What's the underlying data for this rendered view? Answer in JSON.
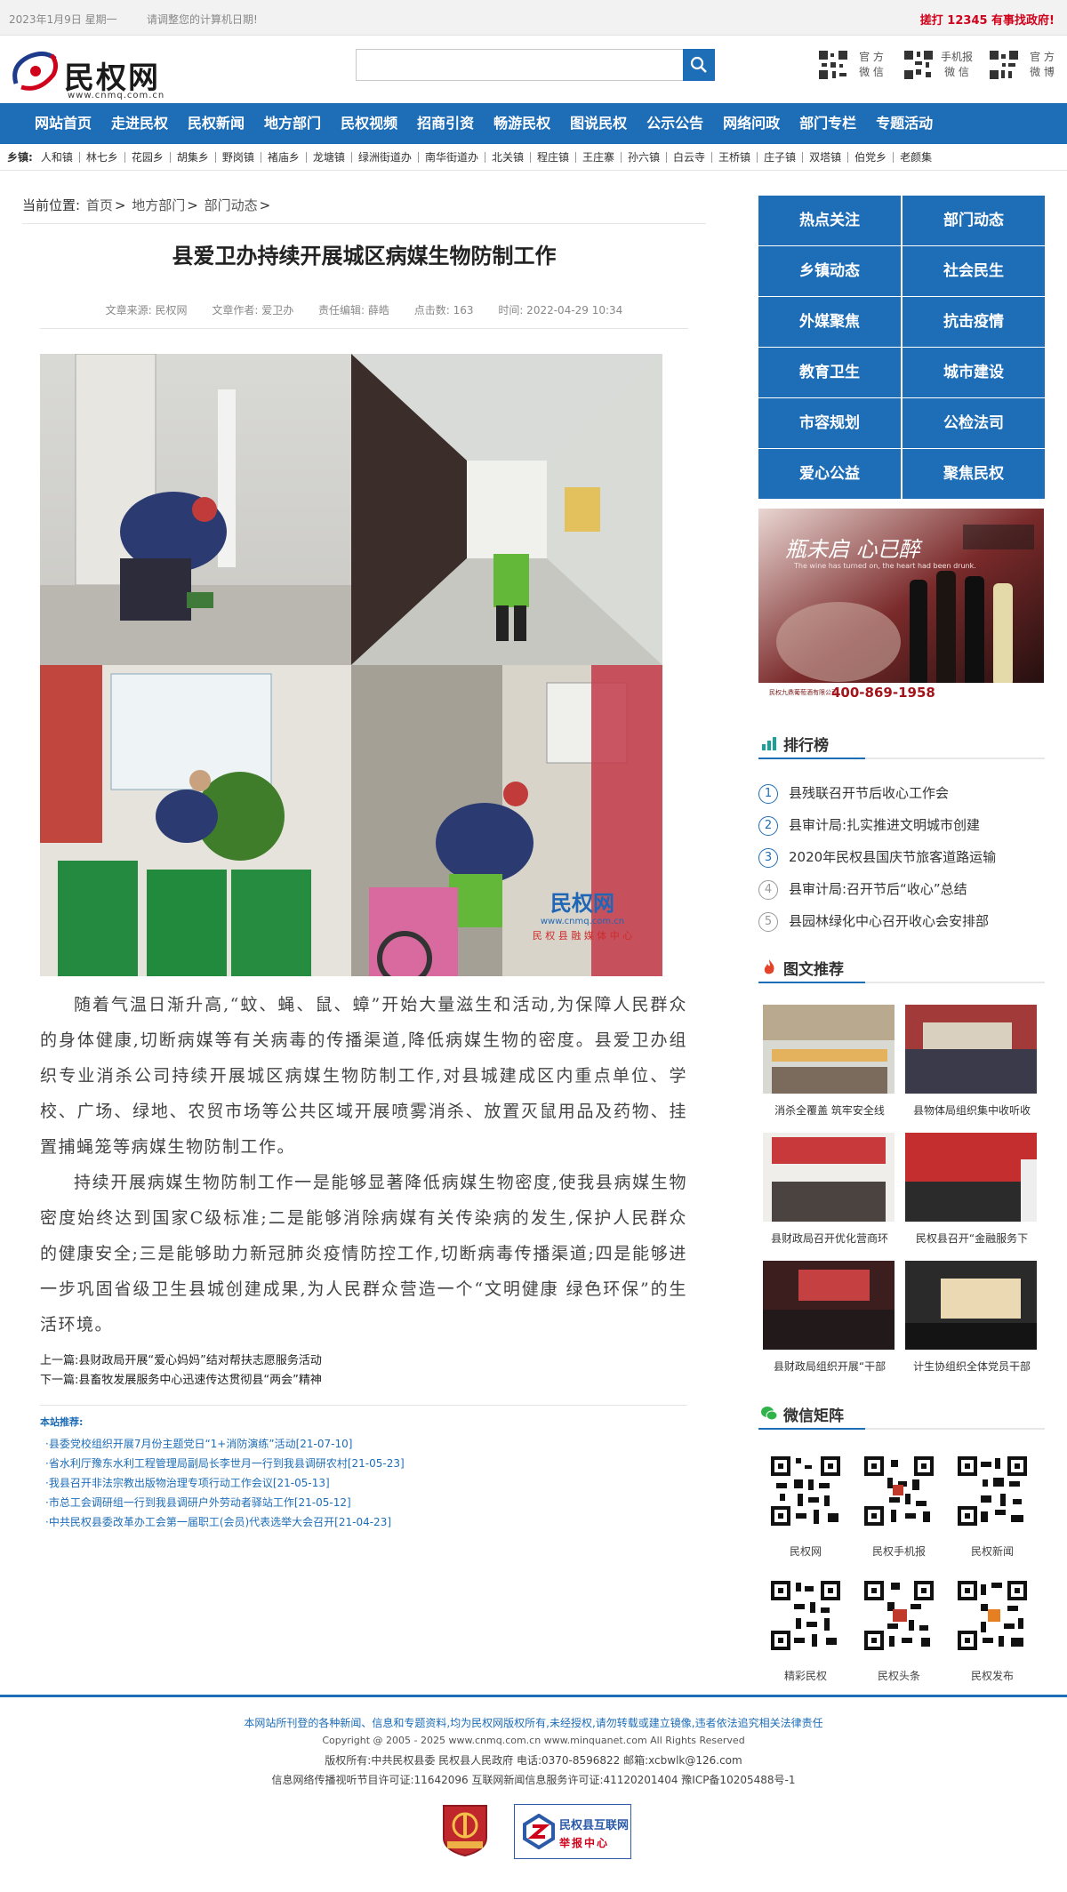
{
  "topbar": {
    "date": "2023年1月9日  星期一",
    "hint": "请调整您的计算机日期!",
    "hotline": "搓打  12345  有事找政府!"
  },
  "logo": {
    "name": "民权网",
    "url": "www.cnmq.com.cn"
  },
  "search": {
    "placeholder": "",
    "icon": "search-icon"
  },
  "qr_links": [
    {
      "l1": "官  方",
      "l2": "微  信"
    },
    {
      "l1": "手机报",
      "l2": "微  信"
    },
    {
      "l1": "官  方",
      "l2": "微  博"
    }
  ],
  "nav": [
    "网站首页",
    "走进民权",
    "民权新闻",
    "地方部门",
    "民权视频",
    "招商引资",
    "畅游民权",
    "图说民权",
    "公示公告",
    "网络问政",
    "部门专栏",
    "专题活动"
  ],
  "towns": {
    "label": "乡镇:",
    "items": [
      "人和镇",
      "林七乡",
      "花园乡",
      "胡集乡",
      "野岗镇",
      "褚庙乡",
      "龙塘镇",
      "绿洲街道办",
      "南华街道办",
      "北关镇",
      "程庄镇",
      "王庄寨",
      "孙六镇",
      "白云寺",
      "王桥镇",
      "庄子镇",
      "双塔镇",
      "伯党乡",
      "老颜集"
    ]
  },
  "breadcrumb": {
    "label": "当前位置:",
    "items": [
      "首页",
      "地方部门",
      "部门动态"
    ]
  },
  "article": {
    "title": "县爱卫办持续开展城区病媒生物防制工作",
    "meta": {
      "source": "文章来源: 民权网",
      "author": "文章作者: 爱卫办",
      "editor": "责任编辑: 薛皓",
      "clicks": "点击数:  163",
      "time": "时间: 2022-04-29 10:34"
    },
    "watermark": {
      "a": "民权网",
      "b": "www.cnmq.com.cn",
      "c": "民 权 县 融 媒 体 中 心"
    },
    "paragraphs": [
      "随着气温日渐升高,“蚊、蝇、鼠、蟑”开始大量滋生和活动,为保障人民群众的身体健康,切断病媒等有关病毒的传播渠道,降低病媒生物的密度。县爱卫办组织专业消杀公司持续开展城区病媒生物防制工作,对县城建成区内重点单位、学校、广场、绿地、农贸市场等公共区域开展喷雾消杀、放置灭鼠用品及药物、挂置捕蝇笼等病媒生物防制工作。",
      "持续开展病媒生物防制工作一是能够显著降低病媒生物密度,使我县病媒生物密度始终达到国家C级标准;二是能够消除病媒有关传染病的发生,保护人民群众的健康安全;三是能够助力新冠肺炎疫情防控工作,切断病毒传播渠道;四是能够进一步巩固省级卫生县城创建成果,为人民群众营造一个“文明健康 绿色环保”的生活环境。"
    ],
    "prev": "上一篇:县财政局开展“爱心妈妈”结对帮扶志愿服务活动",
    "next": "下一篇:县畜牧发展服务中心迅速传达贯彻县“两会”精神"
  },
  "recommend": {
    "title": "本站推荐:",
    "items": [
      "·县委党校组织开展7月份主题党日“1+消防演练”活动[21-07-10]",
      "·省水利厅豫东水利工程管理局副局长李世月一行到我县调研农村[21-05-23]",
      "·我县召开非法宗教出版物治理专项行动工作会议[21-05-13]",
      "·市总工会调研组一行到我县调研户外劳动者驿站工作[21-05-12]",
      "·中共民权县委改革办工会第一届职工(会员)代表选举大会召开[21-04-23]"
    ]
  },
  "side_categories": [
    "热点关注",
    "部门动态",
    "乡镇动态",
    "社会民生",
    "外媒聚焦",
    "抗击疫情",
    "教育卫生",
    "城市建设",
    "市容规划",
    "公检法司",
    "爱心公益",
    "聚焦民权"
  ],
  "ad": {
    "slogan": "瓶未启  心已醉",
    "sub": "The wine has turned on, the heart had been drunk.",
    "phone": "400-869-1958",
    "brand": "民权九鼎葡萄酒有限公司"
  },
  "ranking": {
    "title": "排行榜",
    "items": [
      "县残联召开节后收心工作会",
      "县审计局:扎实推进文明城市创建",
      "2020年民权县国庆节旅客道路运输",
      "县审计局:召开节后“收心”总结",
      "县园林绿化中心召开收心会安排部"
    ]
  },
  "pics": {
    "title": "图文推荐",
    "items": [
      "消杀全覆盖 筑牢安全线",
      "县物体局组织集中收听收",
      "县财政局召开优化营商环",
      "民权县召开“金融服务下",
      "县财政局组织开展“干部",
      "计生协组织全体党员干部"
    ]
  },
  "wechat": {
    "title": "微信矩阵",
    "items": [
      "民权网",
      "民权手机报",
      "民权新闻",
      "精彩民权",
      "民权头条",
      "民权发布"
    ]
  },
  "footer": {
    "notice": "本网站所刊登的各种新闻、信息和专题资料,均为民权网版权所有,未经授权,请勿转载或建立镜像,违者依法追究相关法律责任",
    "copyright": "Copyright @ 2005 - 2025 www.cnmq.com.cn www.minquanet.com All Rights Reserved",
    "owner": "版权所有:中共民权县委 民权县人民政府 电话:0370-8596822 邮箱:xcbwlk@126.com",
    "license": "信息网络传播视听节目许可证:11642096  互联网新闻信息服务许可证:41120201404  豫ICP备10205488号-1",
    "badge_report": {
      "t1": "民权县互联网",
      "t2": "举报中心"
    }
  },
  "colors": {
    "primary": "#1e6db7",
    "hotline": "#d0021b"
  }
}
